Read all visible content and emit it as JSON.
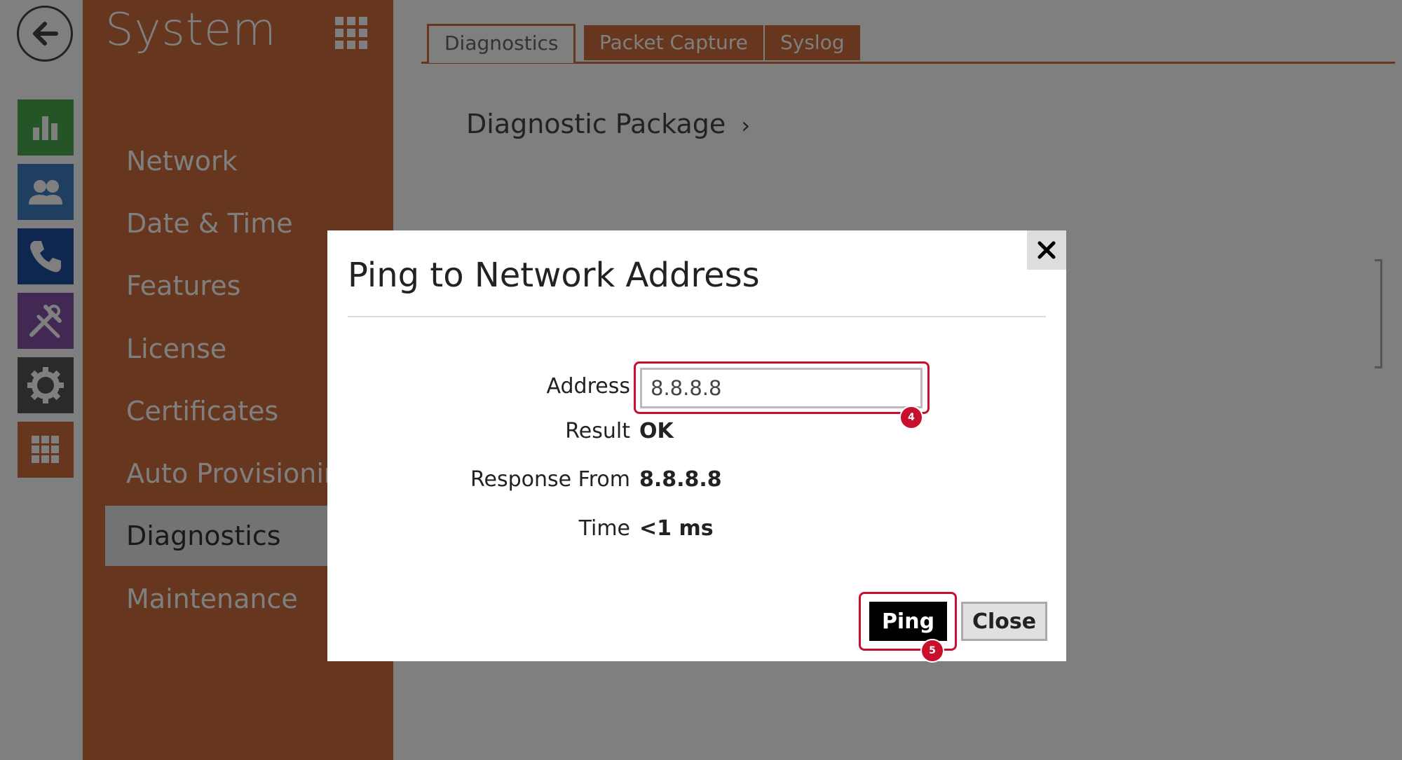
{
  "sidebar": {
    "title": "System",
    "items": [
      {
        "label": "Network"
      },
      {
        "label": "Date & Time"
      },
      {
        "label": "Features"
      },
      {
        "label": "License"
      },
      {
        "label": "Certificates"
      },
      {
        "label": "Auto Provisioning"
      },
      {
        "label": "Diagnostics"
      },
      {
        "label": "Maintenance"
      }
    ],
    "active_item": "Diagnostics"
  },
  "rail": {
    "icons": [
      "back-arrow-icon",
      "bar-chart-icon",
      "users-icon",
      "phone-icon",
      "tools-icon",
      "gear-icon",
      "apps-grid-icon"
    ],
    "colors": {
      "chart": "#4aa84f",
      "users": "#3f7fc0",
      "phone": "#1f4e9c",
      "tools": "#8352a8",
      "gear": "#555555",
      "apps": "#cc6e3c"
    }
  },
  "tabs": [
    {
      "label": "Diagnostics",
      "active": true
    },
    {
      "label": "Packet Capture",
      "active": false
    },
    {
      "label": "Syslog",
      "active": false
    }
  ],
  "main": {
    "page_link": "Diagnostic Package",
    "page_link_chevron": "›"
  },
  "dialog": {
    "title": "Ping to Network Address",
    "close_symbol": "✕",
    "fields": {
      "address_label": "Address",
      "address_value": "8.8.8.8",
      "result_label": "Result",
      "result_value": "OK",
      "response_label": "Response From",
      "response_value": "8.8.8.8",
      "time_label": "Time",
      "time_value": "<1 ms"
    },
    "ping_label": "Ping",
    "close_label": "Close",
    "badges": {
      "address": "4",
      "ping": "5"
    }
  },
  "colors": {
    "accent": "#cc6e3c",
    "highlight": "#c8102e"
  }
}
